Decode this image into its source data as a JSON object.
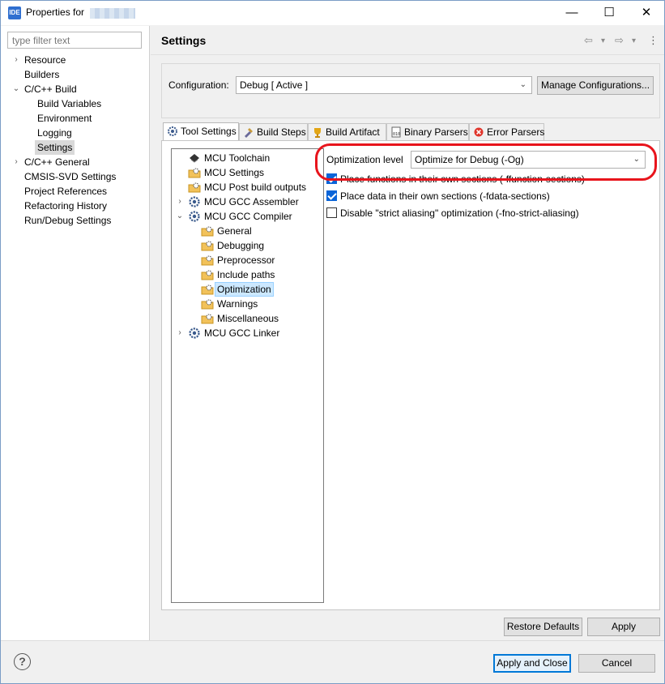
{
  "window": {
    "title": "Properties for",
    "minimize": "—",
    "maximize": "☐",
    "close": "✕",
    "app_icon_text": "IDE"
  },
  "filter": {
    "placeholder": "type filter text"
  },
  "left_nav": [
    {
      "label": "Resource",
      "arrow": "›"
    },
    {
      "label": "Builders",
      "arrow": ""
    },
    {
      "label": "C/C++ Build",
      "arrow": "⌄"
    },
    {
      "label": "Build Variables",
      "arrow": ""
    },
    {
      "label": "Environment",
      "arrow": ""
    },
    {
      "label": "Logging",
      "arrow": ""
    },
    {
      "label": "Settings",
      "arrow": "",
      "selected": true
    },
    {
      "label": "C/C++ General",
      "arrow": "›"
    },
    {
      "label": "CMSIS-SVD Settings",
      "arrow": ""
    },
    {
      "label": "Project References",
      "arrow": ""
    },
    {
      "label": "Refactoring History",
      "arrow": ""
    },
    {
      "label": "Run/Debug Settings",
      "arrow": ""
    }
  ],
  "header": {
    "title": "Settings",
    "back_icon": "⇦",
    "forward_icon": "⇨",
    "dropdown_icon": "▾",
    "menu_icon": "⋮"
  },
  "configuration": {
    "label": "Configuration:",
    "value": "Debug  [ Active ]",
    "manage_label": "Manage Configurations..."
  },
  "tabs": [
    {
      "label": "Tool Settings",
      "icon": "gear-icon",
      "active": true
    },
    {
      "label": "Build Steps",
      "icon": "build-steps-icon"
    },
    {
      "label": "Build Artifact",
      "icon": "trophy-icon"
    },
    {
      "label": "Binary Parsers",
      "icon": "binary-icon"
    },
    {
      "label": "Error Parsers",
      "icon": "error-icon"
    }
  ],
  "tool_tree": [
    {
      "label": "MCU Toolchain",
      "icon": "chip-icon",
      "arrow": ""
    },
    {
      "label": "MCU Settings",
      "icon": "folder-gear-icon",
      "arrow": ""
    },
    {
      "label": "MCU Post build outputs",
      "icon": "folder-gear-icon",
      "arrow": ""
    },
    {
      "label": "MCU GCC Assembler",
      "icon": "gear-icon",
      "arrow": "›"
    },
    {
      "label": "MCU GCC Compiler",
      "icon": "gear-icon",
      "arrow": "⌄"
    },
    {
      "label": "General",
      "icon": "folder-gear-icon",
      "arrow": ""
    },
    {
      "label": "Debugging",
      "icon": "folder-gear-icon",
      "arrow": ""
    },
    {
      "label": "Preprocessor",
      "icon": "folder-gear-icon",
      "arrow": ""
    },
    {
      "label": "Include paths",
      "icon": "folder-gear-icon",
      "arrow": ""
    },
    {
      "label": "Optimization",
      "icon": "folder-gear-icon",
      "arrow": "",
      "selected": true
    },
    {
      "label": "Warnings",
      "icon": "folder-gear-icon",
      "arrow": ""
    },
    {
      "label": "Miscellaneous",
      "icon": "folder-gear-icon",
      "arrow": ""
    },
    {
      "label": "MCU GCC Linker",
      "icon": "gear-icon",
      "arrow": "›"
    }
  ],
  "optimization": {
    "level_label": "Optimization level",
    "level_value": "Optimize for Debug (-Og)",
    "options": [
      {
        "label": "Place functions in their own sections (-ffunction-sections)",
        "checked": true
      },
      {
        "label": "Place data in their own sections (-fdata-sections)",
        "checked": true
      },
      {
        "label": "Disable \"strict aliasing\" optimization (-fno-strict-aliasing)",
        "checked": false
      }
    ]
  },
  "buttons": {
    "restore_defaults": "Restore Defaults",
    "apply": "Apply",
    "apply_and_close": "Apply and Close",
    "cancel": "Cancel",
    "help": "?"
  },
  "colors": {
    "accent": "#0078d7",
    "highlight_oval": "#e8141c",
    "tree_selection": "#cce8ff"
  }
}
